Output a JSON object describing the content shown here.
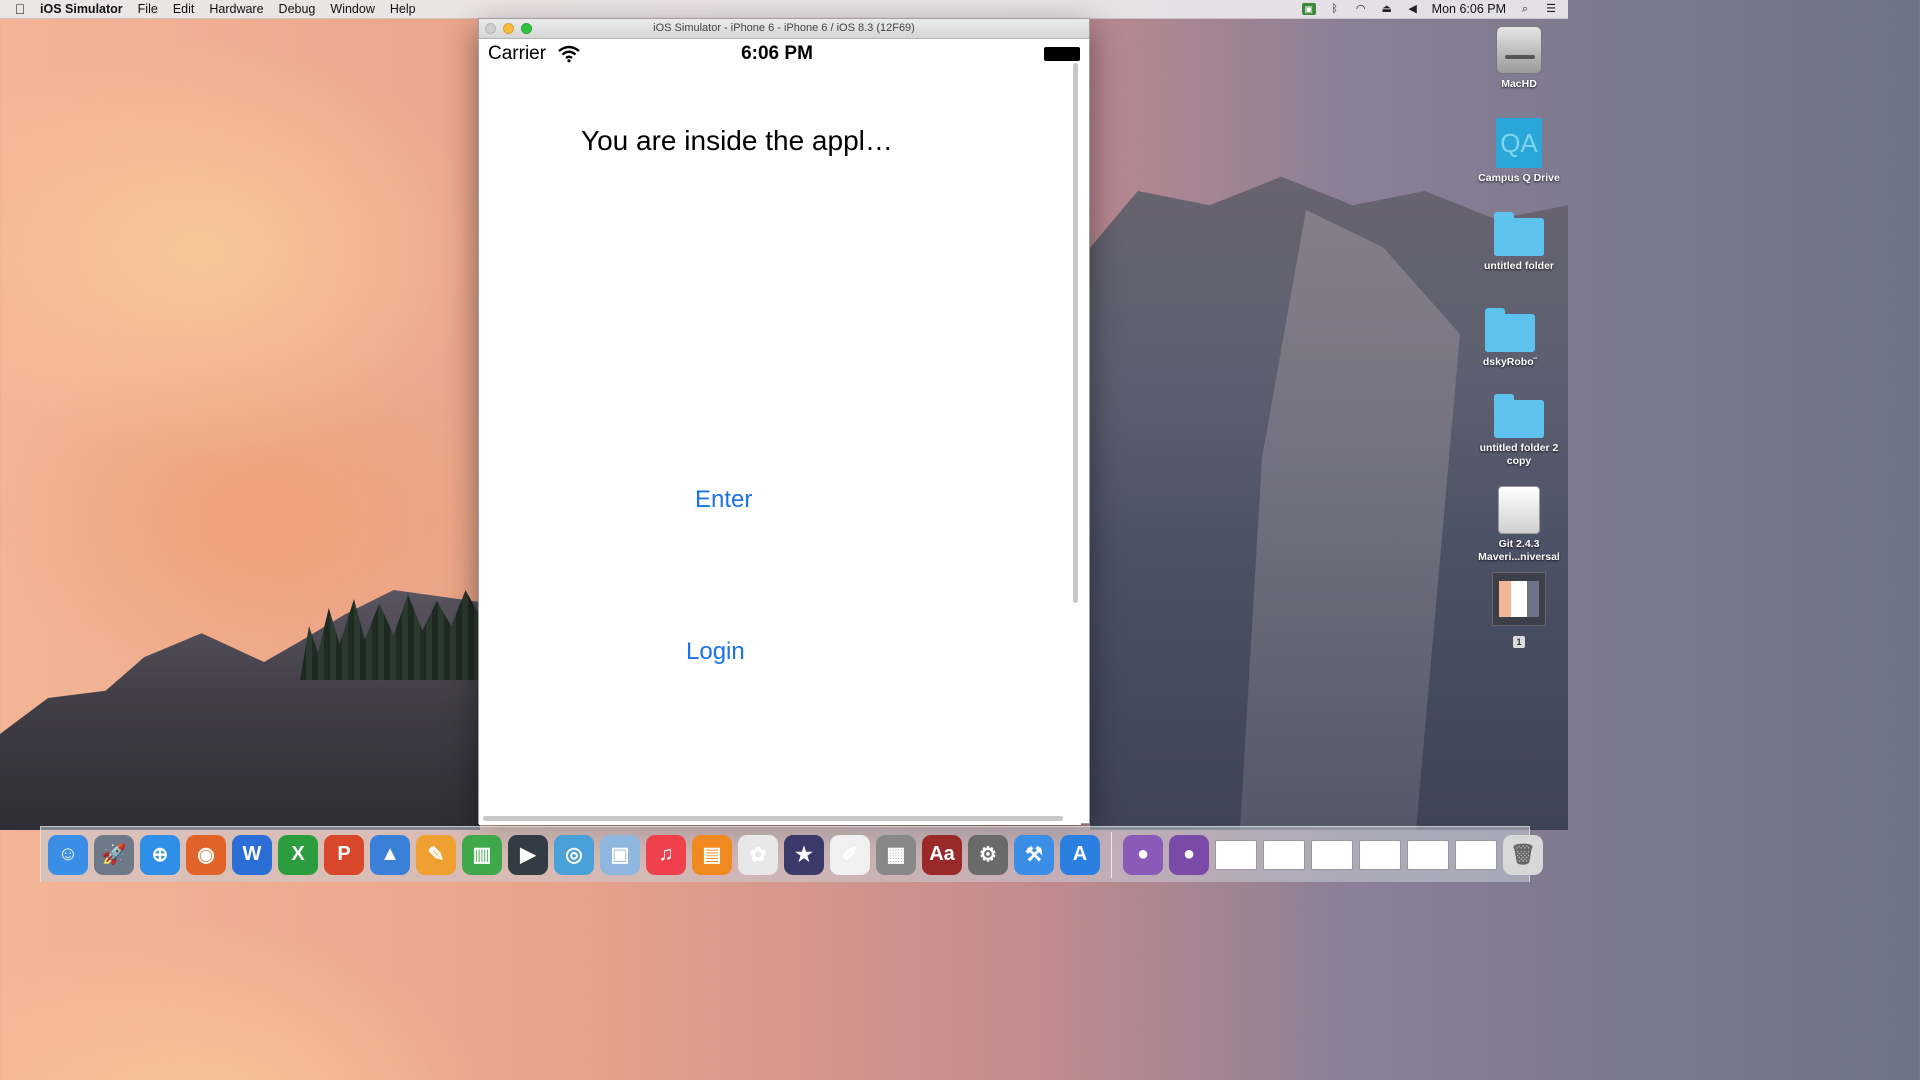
{
  "menubar": {
    "app_name": "iOS Simulator",
    "items": [
      "File",
      "Edit",
      "Hardware",
      "Debug",
      "Window",
      "Help"
    ],
    "clock": "Mon 6:06 PM"
  },
  "window": {
    "title": "iOS Simulator - iPhone 6 - iPhone 6 / iOS 8.3 (12F69)"
  },
  "phone": {
    "status_bar": {
      "carrier": "Carrier",
      "time": "6:06 PM"
    },
    "heading": "You are inside the appl…",
    "enter_label": "Enter",
    "login_label": "Login",
    "accent_color": "#1a73e8"
  },
  "desktop_icons": [
    {
      "label": "MacHD",
      "icon": "hard-drive-icon"
    },
    {
      "label": "Campus Q Drive",
      "icon": "qa-icon"
    },
    {
      "label": "untitled folder",
      "icon": "folder-icon"
    },
    {
      "label": "dskyRobo˝",
      "icon": "folder-icon"
    },
    {
      "label": "untitled folder 2 copy",
      "icon": "folder-icon"
    },
    {
      "label": "Git 2.4.3 Maveri...niversal",
      "icon": "disk-image-icon"
    },
    {
      "label": "1",
      "icon": "screenshot-thumbnail"
    }
  ],
  "dock": {
    "apps": [
      {
        "name": "finder-icon",
        "glyph": "☺",
        "color": "#3a8ee6"
      },
      {
        "name": "launchpad-icon",
        "glyph": "🚀",
        "color": "#6e7a88"
      },
      {
        "name": "safari-icon",
        "glyph": "⊕",
        "color": "#2f8fe8"
      },
      {
        "name": "firefox-icon",
        "glyph": "◉",
        "color": "#e2632a"
      },
      {
        "name": "word-icon",
        "glyph": "W",
        "color": "#2b6fd6"
      },
      {
        "name": "excel-icon",
        "glyph": "X",
        "color": "#2c9d3f"
      },
      {
        "name": "powerpoint-icon",
        "glyph": "P",
        "color": "#d9472b"
      },
      {
        "name": "keynote-icon",
        "glyph": "▲",
        "color": "#3a7fd8"
      },
      {
        "name": "pages-icon",
        "glyph": "✎",
        "color": "#f0a030"
      },
      {
        "name": "numbers-icon",
        "glyph": "▥",
        "color": "#3fa84a"
      },
      {
        "name": "imovie-icon",
        "glyph": "▶",
        "color": "#333b44"
      },
      {
        "name": "network-icon",
        "glyph": "◎",
        "color": "#4aa0d8"
      },
      {
        "name": "virtualbox-icon",
        "glyph": "▣",
        "color": "#8fb6de"
      },
      {
        "name": "itunes-icon",
        "glyph": "♫",
        "color": "#f0404e"
      },
      {
        "name": "ibooks-icon",
        "glyph": "▤",
        "color": "#f08a20"
      },
      {
        "name": "photos-icon",
        "glyph": "✿",
        "color": "#e8e8e8"
      },
      {
        "name": "imovie-star-icon",
        "glyph": "★",
        "color": "#3a3a6a"
      },
      {
        "name": "textedit-icon",
        "glyph": "✐",
        "color": "#f0f0f0"
      },
      {
        "name": "calculator-icon",
        "glyph": "▦",
        "color": "#888888"
      },
      {
        "name": "dictionary-icon",
        "glyph": "Aa",
        "color": "#9a2a2a"
      },
      {
        "name": "system-preferences-icon",
        "glyph": "⚙",
        "color": "#6a6a6a"
      },
      {
        "name": "xcode-icon",
        "glyph": "⚒",
        "color": "#3a8ee6"
      },
      {
        "name": "app-store-icon",
        "glyph": "A",
        "color": "#2a7fe0"
      },
      {
        "name": "github-icon",
        "glyph": "●",
        "color": "#8a5ab8"
      },
      {
        "name": "github-desktop-icon",
        "glyph": "●",
        "color": "#7a4aa8"
      }
    ],
    "minimized_windows": 6,
    "trash": {
      "name": "trash-icon",
      "glyph": "🗑",
      "color": "#d8d8d8"
    }
  }
}
